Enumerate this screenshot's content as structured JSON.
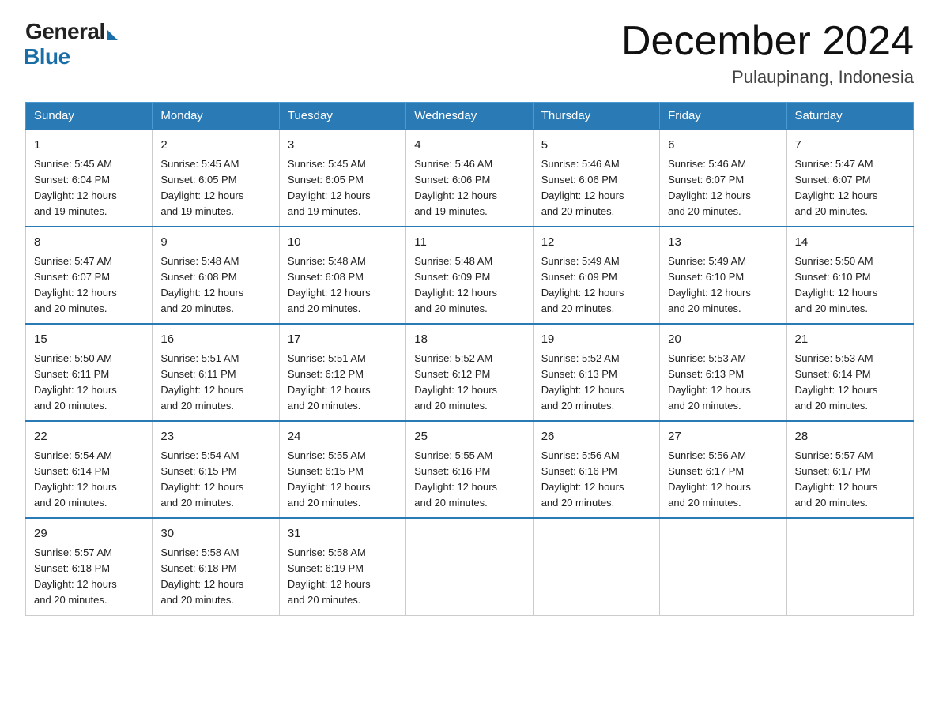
{
  "header": {
    "logo_general": "General",
    "logo_blue": "Blue",
    "month_title": "December 2024",
    "location": "Pulaupinang, Indonesia"
  },
  "days_of_week": [
    "Sunday",
    "Monday",
    "Tuesday",
    "Wednesday",
    "Thursday",
    "Friday",
    "Saturday"
  ],
  "weeks": [
    [
      {
        "day": "1",
        "sunrise": "5:45 AM",
        "sunset": "6:04 PM",
        "daylight": "12 hours and 19 minutes."
      },
      {
        "day": "2",
        "sunrise": "5:45 AM",
        "sunset": "6:05 PM",
        "daylight": "12 hours and 19 minutes."
      },
      {
        "day": "3",
        "sunrise": "5:45 AM",
        "sunset": "6:05 PM",
        "daylight": "12 hours and 19 minutes."
      },
      {
        "day": "4",
        "sunrise": "5:46 AM",
        "sunset": "6:06 PM",
        "daylight": "12 hours and 19 minutes."
      },
      {
        "day": "5",
        "sunrise": "5:46 AM",
        "sunset": "6:06 PM",
        "daylight": "12 hours and 20 minutes."
      },
      {
        "day": "6",
        "sunrise": "5:46 AM",
        "sunset": "6:07 PM",
        "daylight": "12 hours and 20 minutes."
      },
      {
        "day": "7",
        "sunrise": "5:47 AM",
        "sunset": "6:07 PM",
        "daylight": "12 hours and 20 minutes."
      }
    ],
    [
      {
        "day": "8",
        "sunrise": "5:47 AM",
        "sunset": "6:07 PM",
        "daylight": "12 hours and 20 minutes."
      },
      {
        "day": "9",
        "sunrise": "5:48 AM",
        "sunset": "6:08 PM",
        "daylight": "12 hours and 20 minutes."
      },
      {
        "day": "10",
        "sunrise": "5:48 AM",
        "sunset": "6:08 PM",
        "daylight": "12 hours and 20 minutes."
      },
      {
        "day": "11",
        "sunrise": "5:48 AM",
        "sunset": "6:09 PM",
        "daylight": "12 hours and 20 minutes."
      },
      {
        "day": "12",
        "sunrise": "5:49 AM",
        "sunset": "6:09 PM",
        "daylight": "12 hours and 20 minutes."
      },
      {
        "day": "13",
        "sunrise": "5:49 AM",
        "sunset": "6:10 PM",
        "daylight": "12 hours and 20 minutes."
      },
      {
        "day": "14",
        "sunrise": "5:50 AM",
        "sunset": "6:10 PM",
        "daylight": "12 hours and 20 minutes."
      }
    ],
    [
      {
        "day": "15",
        "sunrise": "5:50 AM",
        "sunset": "6:11 PM",
        "daylight": "12 hours and 20 minutes."
      },
      {
        "day": "16",
        "sunrise": "5:51 AM",
        "sunset": "6:11 PM",
        "daylight": "12 hours and 20 minutes."
      },
      {
        "day": "17",
        "sunrise": "5:51 AM",
        "sunset": "6:12 PM",
        "daylight": "12 hours and 20 minutes."
      },
      {
        "day": "18",
        "sunrise": "5:52 AM",
        "sunset": "6:12 PM",
        "daylight": "12 hours and 20 minutes."
      },
      {
        "day": "19",
        "sunrise": "5:52 AM",
        "sunset": "6:13 PM",
        "daylight": "12 hours and 20 minutes."
      },
      {
        "day": "20",
        "sunrise": "5:53 AM",
        "sunset": "6:13 PM",
        "daylight": "12 hours and 20 minutes."
      },
      {
        "day": "21",
        "sunrise": "5:53 AM",
        "sunset": "6:14 PM",
        "daylight": "12 hours and 20 minutes."
      }
    ],
    [
      {
        "day": "22",
        "sunrise": "5:54 AM",
        "sunset": "6:14 PM",
        "daylight": "12 hours and 20 minutes."
      },
      {
        "day": "23",
        "sunrise": "5:54 AM",
        "sunset": "6:15 PM",
        "daylight": "12 hours and 20 minutes."
      },
      {
        "day": "24",
        "sunrise": "5:55 AM",
        "sunset": "6:15 PM",
        "daylight": "12 hours and 20 minutes."
      },
      {
        "day": "25",
        "sunrise": "5:55 AM",
        "sunset": "6:16 PM",
        "daylight": "12 hours and 20 minutes."
      },
      {
        "day": "26",
        "sunrise": "5:56 AM",
        "sunset": "6:16 PM",
        "daylight": "12 hours and 20 minutes."
      },
      {
        "day": "27",
        "sunrise": "5:56 AM",
        "sunset": "6:17 PM",
        "daylight": "12 hours and 20 minutes."
      },
      {
        "day": "28",
        "sunrise": "5:57 AM",
        "sunset": "6:17 PM",
        "daylight": "12 hours and 20 minutes."
      }
    ],
    [
      {
        "day": "29",
        "sunrise": "5:57 AM",
        "sunset": "6:18 PM",
        "daylight": "12 hours and 20 minutes."
      },
      {
        "day": "30",
        "sunrise": "5:58 AM",
        "sunset": "6:18 PM",
        "daylight": "12 hours and 20 minutes."
      },
      {
        "day": "31",
        "sunrise": "5:58 AM",
        "sunset": "6:19 PM",
        "daylight": "12 hours and 20 minutes."
      },
      null,
      null,
      null,
      null
    ]
  ],
  "labels": {
    "sunrise": "Sunrise:",
    "sunset": "Sunset:",
    "daylight": "Daylight:"
  }
}
